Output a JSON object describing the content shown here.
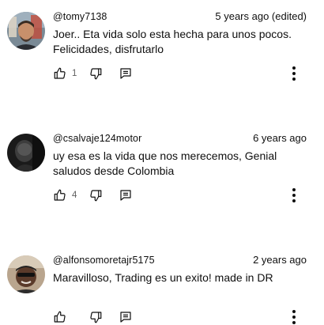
{
  "comments": [
    {
      "author": "@tomy7138",
      "time": "5 years ago (edited)",
      "text": "Joer.. Eta vida solo esta hecha para unos pocos. Felicidades, disfrutarlo",
      "like_count": "1"
    },
    {
      "author": "@csalvaje124motor",
      "time": "6 years ago",
      "text": "uy esa es la vida que nos merecemos, Genial saludos desde Colombia",
      "like_count": "4"
    },
    {
      "author": "@alfonsomoretajr5175",
      "time": "2 years ago",
      "text": "Maravilloso, Trading es un exito! made in DR",
      "like_count": ""
    }
  ],
  "icons": {
    "like": "thumb-up-icon",
    "dislike": "thumb-down-icon",
    "reply": "reply-comment-icon",
    "more": "more-vertical-icon"
  },
  "colors": {
    "text": "#0f0f0f",
    "secondary": "#606060"
  }
}
